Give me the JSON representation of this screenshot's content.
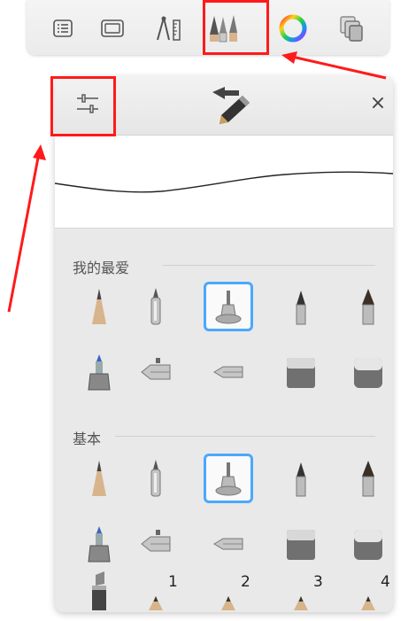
{
  "toolbar": {
    "items": [
      {
        "name": "brush-list-button",
        "icon": "list-icon"
      },
      {
        "name": "canvas-button",
        "icon": "canvas-icon"
      },
      {
        "name": "guides-button",
        "icon": "compass-ruler-icon"
      },
      {
        "name": "brushes-button",
        "icon": "brush-set-icon",
        "highlighted": true
      },
      {
        "name": "color-button",
        "icon": "color-wheel-icon"
      },
      {
        "name": "layers-button",
        "icon": "layers-icon"
      }
    ]
  },
  "panel": {
    "close_label": "×",
    "favorites_label": "我的最爱",
    "basic_label": "基本",
    "selected_brush_index": 2,
    "favorites": [
      "pencil",
      "airbrush",
      "fineliner",
      "paintbrush-small",
      "paintbrush-large",
      "marker",
      "ballpoint-pen",
      "felt-pen",
      "eraser-hard",
      "eraser-soft"
    ],
    "basic": [
      "pencil",
      "airbrush",
      "fineliner",
      "paintbrush-small",
      "paintbrush-large",
      "marker",
      "ballpoint-pen",
      "felt-pen",
      "eraser-hard",
      "eraser-soft"
    ],
    "bottom_row": {
      "items": [
        "chisel-marker",
        "blend-1",
        "blend-2",
        "blend-3",
        "blend-4"
      ],
      "numbers": [
        "1",
        "2",
        "3",
        "4"
      ]
    }
  },
  "colors": {
    "highlight": "#ff1a1a",
    "selection": "#4aa8ff",
    "panel_bg": "#e9e9e9"
  }
}
